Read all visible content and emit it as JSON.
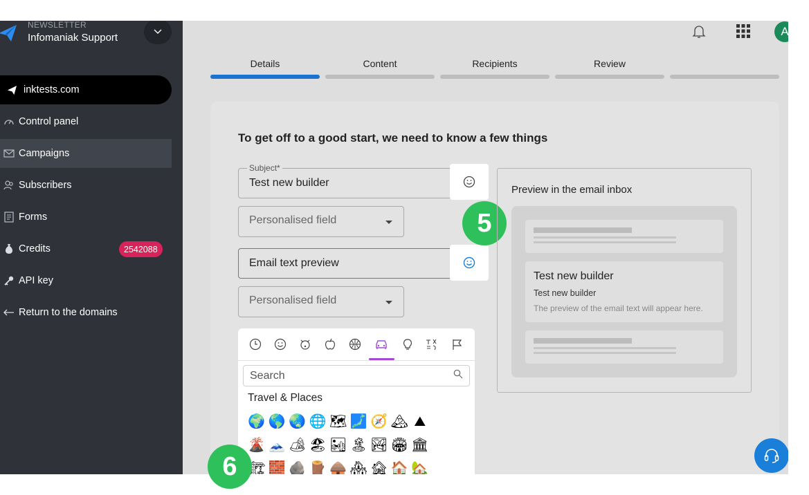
{
  "sidebar": {
    "brand_small": "NEWSLETTER",
    "brand_name": "Infomaniak Support",
    "items": [
      {
        "label": "inktests.com",
        "icon": "paper-plane-icon"
      },
      {
        "label": "Control panel",
        "icon": "gauge-icon"
      },
      {
        "label": "Campaigns",
        "icon": "envelope-icon"
      },
      {
        "label": "Subscribers",
        "icon": "users-icon"
      },
      {
        "label": "Forms",
        "icon": "form-icon"
      },
      {
        "label": "Credits",
        "icon": "coin-bag-icon",
        "badge": "2542088"
      },
      {
        "label": "API key",
        "icon": "key-icon"
      },
      {
        "label": "Return to the domains",
        "icon": "arrow-left-icon"
      }
    ]
  },
  "header": {
    "avatar_initial": "A"
  },
  "steps": [
    {
      "label": "Details",
      "state": "done"
    },
    {
      "label": "Content",
      "state": "todo"
    },
    {
      "label": "Recipients",
      "state": "todo"
    },
    {
      "label": "Review",
      "state": "todo"
    },
    {
      "label": "",
      "state": "todo"
    }
  ],
  "form": {
    "title": "To get off to a good start, we need to know a few things",
    "subject_label": "Subject*",
    "subject_value": "Test new builder",
    "personalised_field_1": "Personalised field",
    "preview_placeholder": "Email text preview",
    "personalised_field_2": "Personalised field"
  },
  "markers": {
    "five": "5",
    "six": "6"
  },
  "preview": {
    "title": "Preview in the email inbox",
    "subject": "Test new builder",
    "sender": "Test new builder",
    "text": "The preview of the email text will appear here."
  },
  "emoji_picker": {
    "active_category": "Travel & Places",
    "search_placeholder": "Search",
    "category_title": "Travel & Places",
    "rows": [
      [
        "🌍",
        "🌎",
        "🌏",
        "🌐",
        "🗺",
        "🗾",
        "🧭",
        "🏔",
        "⛰"
      ],
      [
        "🌋",
        "🗻",
        "🏕",
        "🏖",
        "🏜",
        "🏝",
        "🏞",
        "🏟",
        "🏛"
      ],
      [
        "🏗",
        "🧱",
        "🪨",
        "🪵",
        "🛖",
        "🏘",
        "🏚",
        "🏠",
        "🏡"
      ]
    ]
  },
  "colors": {
    "accent": "#1a73d0",
    "sidebar": "#2f3238",
    "badge": "#d6245a",
    "marker": "#2ec05a",
    "picker_active": "#a04bd0"
  }
}
